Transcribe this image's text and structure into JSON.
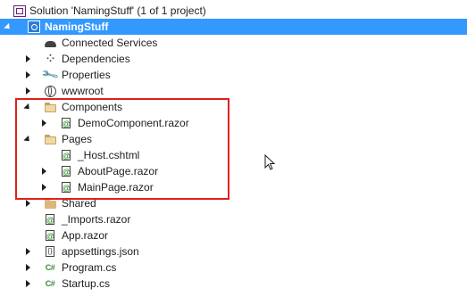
{
  "tree": {
    "solution": {
      "label": "Solution 'NamingStuff' (1 of 1 project)",
      "icon": "solution-icon"
    },
    "project": {
      "label": "NamingStuff",
      "icon": "csharp-web-project-icon"
    },
    "items": [
      {
        "label": "Connected Services",
        "icon": "cloud-icon"
      },
      {
        "label": "Dependencies",
        "icon": "dependencies-icon"
      },
      {
        "label": "Properties",
        "icon": "wrench-icon"
      },
      {
        "label": "wwwroot",
        "icon": "globe-icon"
      },
      {
        "label": "Components",
        "icon": "folder-open-icon"
      },
      {
        "label": "DemoComponent.razor",
        "icon": "razor-file-icon"
      },
      {
        "label": "Pages",
        "icon": "folder-open-icon"
      },
      {
        "label": "_Host.cshtml",
        "icon": "razor-file-icon"
      },
      {
        "label": "AboutPage.razor",
        "icon": "razor-file-icon"
      },
      {
        "label": "MainPage.razor",
        "icon": "razor-file-icon"
      },
      {
        "label": "Shared",
        "icon": "folder-icon"
      },
      {
        "label": "_Imports.razor",
        "icon": "razor-file-icon"
      },
      {
        "label": "App.razor",
        "icon": "razor-file-icon"
      },
      {
        "label": "appsettings.json",
        "icon": "json-file-icon"
      },
      {
        "label": "Program.cs",
        "icon": "csharp-file-icon"
      },
      {
        "label": "Startup.cs",
        "icon": "csharp-file-icon"
      }
    ]
  },
  "colors": {
    "selection": "#3399ff",
    "highlight_box": "#e0201c",
    "folder": "#dcb67a"
  }
}
